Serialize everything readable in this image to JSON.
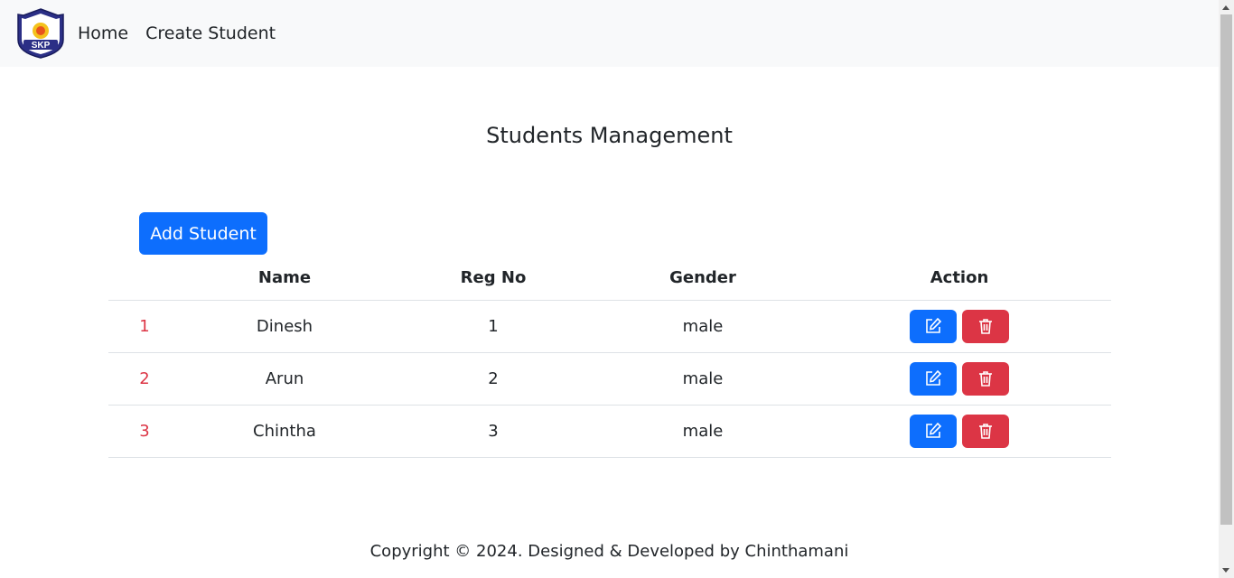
{
  "navbar": {
    "logo_text": "SKP",
    "links": [
      "Home",
      "Create Student"
    ]
  },
  "page": {
    "title": "Students Management",
    "add_button_label": "Add Student"
  },
  "table": {
    "headers": [
      "",
      "Name",
      "Reg No",
      "Gender",
      "Action"
    ],
    "rows": [
      {
        "index": "1",
        "name": "Dinesh",
        "reg_no": "1",
        "gender": "male"
      },
      {
        "index": "2",
        "name": "Arun",
        "reg_no": "2",
        "gender": "male"
      },
      {
        "index": "3",
        "name": "Chintha",
        "reg_no": "3",
        "gender": "male"
      }
    ],
    "edit_icon": "edit-icon",
    "delete_icon": "trash-icon"
  },
  "footer": {
    "text": "Copyright © 2024. Designed & Developed by Chinthamani"
  },
  "colors": {
    "primary": "#0d6efd",
    "danger": "#dc3545",
    "navbar_bg": "#f8f9fa"
  }
}
